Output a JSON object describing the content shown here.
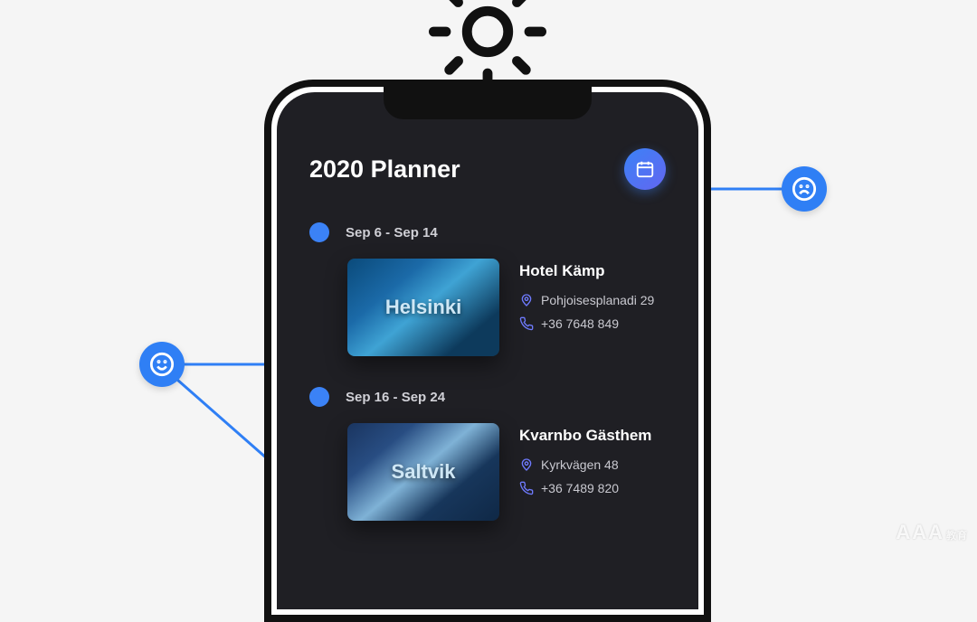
{
  "header": {
    "title": "2020 Planner",
    "calendar_button_name": "calendar"
  },
  "trips": [
    {
      "dates": "Sep 6 - Sep 14",
      "destination": "Helsinki",
      "hotel": "Hotel Kämp",
      "address": "Pohjoisesplanadi 29",
      "phone": "+36 7648 849"
    },
    {
      "dates": "Sep 16 - Sep 24",
      "destination": "Saltvik",
      "hotel": "Kvarnbo Gästhem",
      "address": "Kyrkvägen 48",
      "phone": "+36 7489 820"
    }
  ],
  "annotations": {
    "left": "smile",
    "right": "frown"
  },
  "watermark": {
    "main": "AAA",
    "sub": "教育"
  }
}
